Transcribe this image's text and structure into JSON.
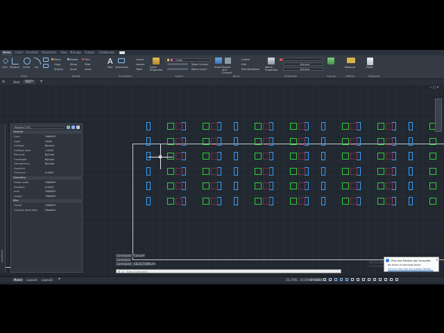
{
  "tabs": [
    "Home",
    "Insert",
    "Annotate",
    "Parametric",
    "View",
    "Manage",
    "Output",
    "Collaborate"
  ],
  "draw_group": {
    "label": "Draw",
    "tools": [
      "Line",
      "Polyline",
      "Circle",
      "Arc"
    ]
  },
  "modify_group": {
    "label": "Modify",
    "tools": [
      "Move",
      "Rotate",
      "Trim",
      "Copy",
      "Mirror",
      "Fillet",
      "Stretch",
      "Scale",
      "Array"
    ]
  },
  "annotation_group": {
    "label": "Annotation",
    "tools": [
      "Text",
      "Dimension",
      "Linear",
      "Leader",
      "Table"
    ]
  },
  "layers_group": {
    "label": "Layers",
    "layer_properties": "Layer Properties",
    "current_layer": "Cable",
    "make_current": "Make Current",
    "match_layer": "Match Layer"
  },
  "block_group": {
    "label": "Block",
    "insert": "Insert",
    "create": "Create",
    "edit": "Edit",
    "edit_attributes": "Edit Attributes"
  },
  "properties_group": {
    "label": "Properties",
    "match_properties": "Match Properties",
    "bylayer_1": "ByLayer",
    "bylayer_2": "ByLayer",
    "bylayer_3": "ByLayer"
  },
  "other_groups": {
    "groups": "Groups",
    "utilities": "Utilities",
    "clipboard": "Clipboard",
    "measure": "Measure",
    "paste": "Paste",
    "search_convert": "Search and Convert"
  },
  "doc_tabs": {
    "start": "Start",
    "active": "TEST*"
  },
  "properties_palette": {
    "selector": "Polyline (131)",
    "sections": {
      "general": "General",
      "geometry": "Geometry",
      "misc": "Misc"
    },
    "general": [
      [
        "Color",
        "*VARIES*"
      ],
      [
        "Layer",
        "Cable"
      ],
      [
        "Linetype",
        "ByLayer"
      ],
      [
        "Linetype scale",
        "1.0000"
      ],
      [
        "Plot style",
        "ByColor"
      ],
      [
        "Lineweight",
        "ByLayer"
      ],
      [
        "Transparency",
        "ByLayer"
      ],
      [
        "Hyperlink",
        ""
      ],
      [
        "Thickness",
        "0.0000"
      ]
    ],
    "geometry": [
      [
        "Global width",
        "*VARIES*"
      ],
      [
        "Elevation",
        "0.0000"
      ],
      [
        "Area",
        "*VARIES*"
      ],
      [
        "Length",
        "*VARIES*"
      ]
    ],
    "misc": [
      [
        "Closed",
        "*VARIES*"
      ],
      [
        "Linetype generation",
        "Disabled"
      ]
    ],
    "strip_label": "PROPERTIES"
  },
  "command": {
    "history": [
      "Command: *Cancel*",
      "Command:",
      "Command: _SELECTSIMILAR"
    ],
    "placeholder": "Type a command"
  },
  "status": {
    "tabs": [
      "Model",
      "Layout1",
      "Layout2"
    ],
    "coords": "25.2765, -54.0598, 0.0000",
    "mode": "MODEL"
  },
  "notification": {
    "title": "Plot and Publish Job Complete",
    "line1": "No errors or warnings found",
    "link": "Click to view plot and publish details..."
  },
  "watermark": {
    "line1": "Activate Windows",
    "line2": "Go to Settings to activate Windows."
  },
  "colors": {
    "blue": "#3aa0ff",
    "green": "#2fcf3a",
    "red": "#8a2a4a",
    "ribbon": "#353b44",
    "canvas": "#212830"
  },
  "grid": {
    "rows": 6,
    "cols_pattern": [
      "blue",
      "green",
      "blue",
      "green",
      "blue",
      "blue",
      "green",
      "blue",
      "green",
      "blue",
      "blue",
      "green",
      "blue",
      "green",
      "blue",
      "blue",
      "green"
    ]
  }
}
